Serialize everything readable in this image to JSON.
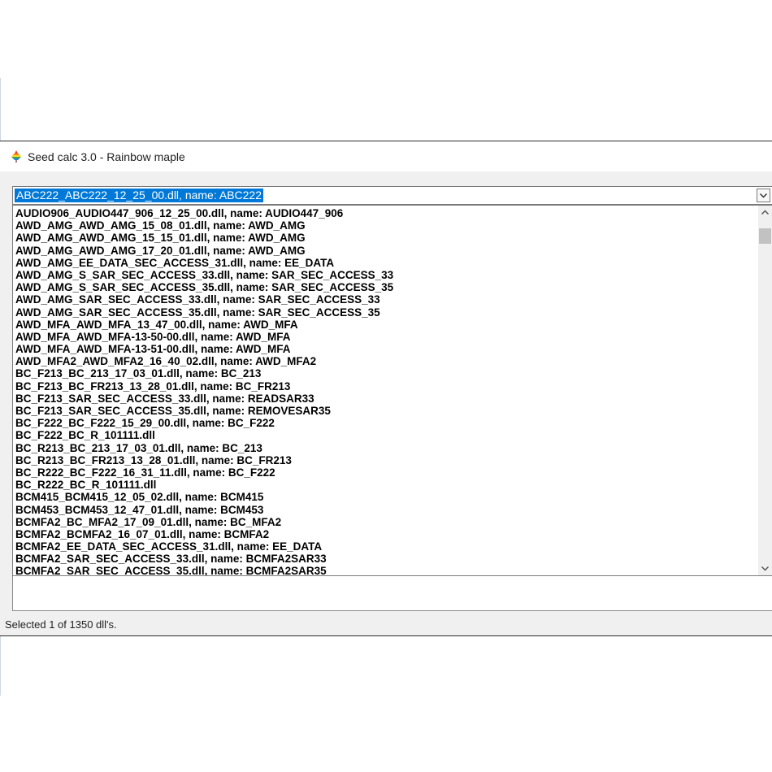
{
  "window": {
    "title": "Seed calc 3.0 - Rainbow maple",
    "icon": "rainbow-maple-icon"
  },
  "combo": {
    "selected_value": "ABC222_ABC222_12_25_00.dll, name: ABC222",
    "dropdown_icon": "chevron-down-icon",
    "highlight_color": "#0078d7"
  },
  "list": {
    "items": [
      "AUDIO906_AUDIO447_906_12_25_00.dll, name: AUDIO447_906",
      "AWD_AMG_AWD_AMG_15_08_01.dll, name: AWD_AMG",
      "AWD_AMG_AWD_AMG_15_15_01.dll, name: AWD_AMG",
      "AWD_AMG_AWD_AMG_17_20_01.dll, name: AWD_AMG",
      "AWD_AMG_EE_DATA_SEC_ACCESS_31.dll, name: EE_DATA",
      "AWD_AMG_S_SAR_SEC_ACCESS_33.dll, name: SAR_SEC_ACCESS_33",
      "AWD_AMG_S_SAR_SEC_ACCESS_35.dll, name: SAR_SEC_ACCESS_35",
      "AWD_AMG_SAR_SEC_ACCESS_33.dll, name: SAR_SEC_ACCESS_33",
      "AWD_AMG_SAR_SEC_ACCESS_35.dll, name: SAR_SEC_ACCESS_35",
      "AWD_MFA_AWD_MFA_13_47_00.dll, name: AWD_MFA",
      "AWD_MFA_AWD_MFA-13-50-00.dll, name: AWD_MFA",
      "AWD_MFA_AWD_MFA-13-51-00.dll, name: AWD_MFA",
      "AWD_MFA2_AWD_MFA2_16_40_02.dll, name: AWD_MFA2",
      "BC_F213_BC_213_17_03_01.dll, name: BC_213",
      "BC_F213_BC_FR213_13_28_01.dll, name: BC_FR213",
      "BC_F213_SAR_SEC_ACCESS_33.dll, name: READSAR33",
      "BC_F213_SAR_SEC_ACCESS_35.dll, name: REMOVESAR35",
      "BC_F222_BC_F222_15_29_00.dll, name: BC_F222",
      "BC_F222_BC_R_101111.dll",
      "BC_R213_BC_213_17_03_01.dll, name: BC_213",
      "BC_R213_BC_FR213_13_28_01.dll, name: BC_FR213",
      "BC_R222_BC_F222_16_31_11.dll, name: BC_F222",
      "BC_R222_BC_R_101111.dll",
      "BCM415_BCM415_12_05_02.dll, name: BCM415",
      "BCM453_BCM453_12_47_01.dll, name: BCM453",
      "BCMFA2_BC_MFA2_17_09_01.dll, name: BC_MFA2",
      "BCMFA2_BCMFA2_16_07_01.dll, name: BCMFA2",
      "BCMFA2_EE_DATA_SEC_ACCESS_31.dll, name: EE_DATA",
      "BCMFA2_SAR_SEC_ACCESS_33.dll, name: BCMFA2SAR33",
      "BCMFA2_SAR_SEC_ACCESS_35.dll, name: BCMFA2SAR35"
    ],
    "scroll_up_icon": "chevron-up-icon",
    "scroll_down_icon": "chevron-down-icon"
  },
  "status": {
    "text": "Selected 1 of 1350 dll's."
  }
}
